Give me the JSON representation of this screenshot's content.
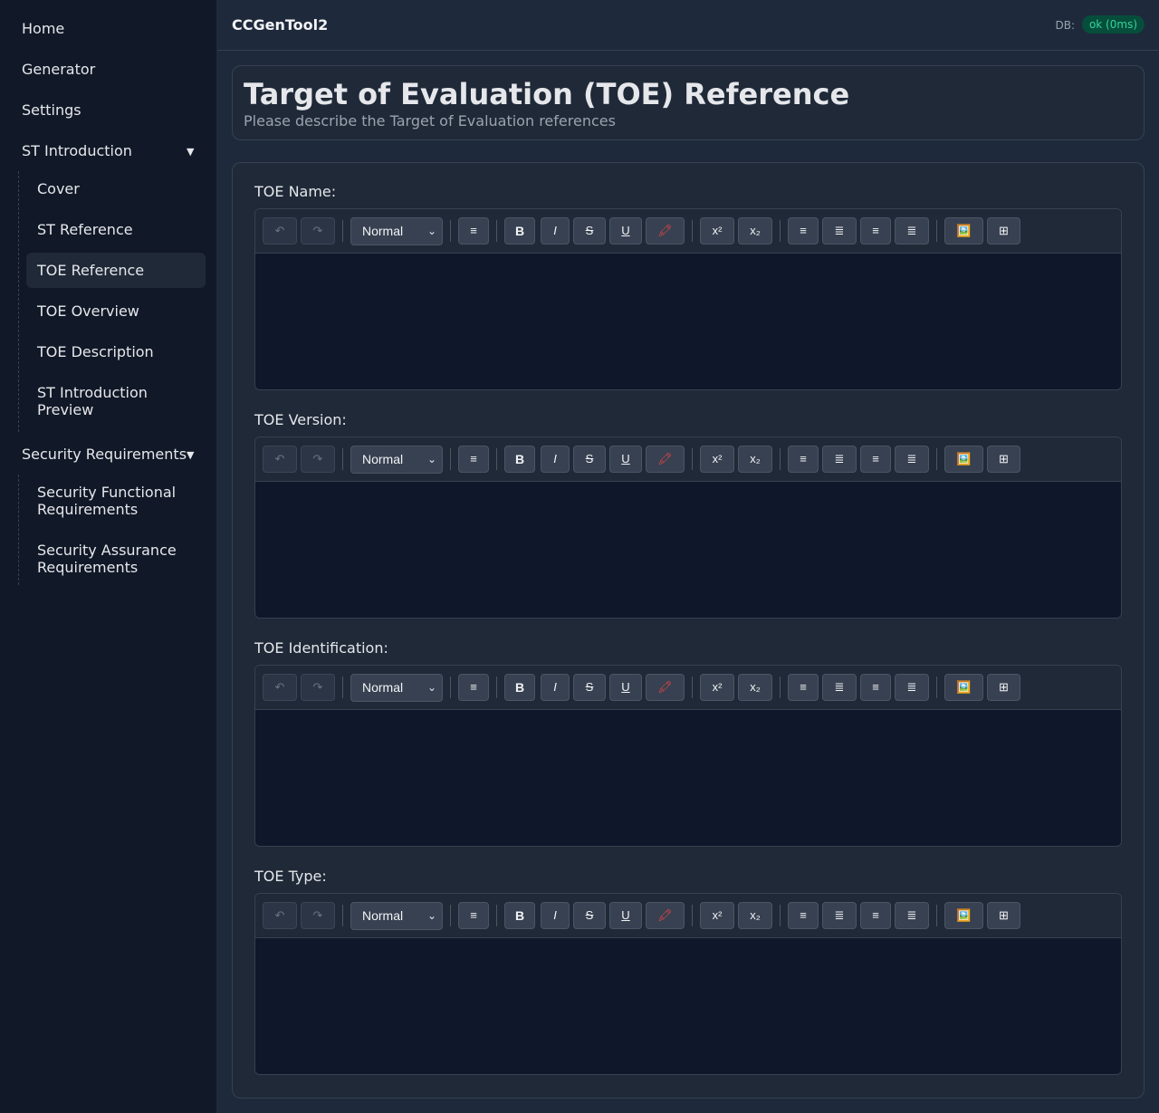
{
  "sidebar": {
    "top_items": [
      {
        "label": "Home"
      },
      {
        "label": "Generator"
      },
      {
        "label": "Settings"
      }
    ],
    "groups": [
      {
        "label": "ST Introduction",
        "caret": "▼",
        "items": [
          {
            "label": "Cover"
          },
          {
            "label": "ST Reference"
          },
          {
            "label": "TOE Reference",
            "active": true
          },
          {
            "label": "TOE Overview"
          },
          {
            "label": "TOE Description"
          },
          {
            "label": "ST Introduction Preview"
          }
        ]
      },
      {
        "label": "Security Requirements",
        "caret": "▼",
        "items": [
          {
            "label": "Security Functional Requirements"
          },
          {
            "label": "Security Assurance Requirements"
          }
        ]
      }
    ]
  },
  "header": {
    "app_title": "CCGenTool2",
    "db_label": "DB:",
    "db_status": "ok (0ms)"
  },
  "page": {
    "title": "Target of Evaluation (TOE) Reference",
    "subtitle": "Please describe the Target of Evaluation references"
  },
  "toolbar": {
    "undo": "↶",
    "redo": "↷",
    "format_select": "Normal",
    "clean": "≡",
    "bold": "B",
    "italic": "I",
    "strike": "S",
    "underline": "U",
    "highlight": "🖍",
    "superscript": "x²",
    "subscript": "x₂",
    "align_left": "≡",
    "align_center": "≣",
    "align_right": "≡",
    "align_justify": "≣",
    "image": "🖼️",
    "table": "⊞"
  },
  "fields": [
    {
      "label": "TOE Name:",
      "value": ""
    },
    {
      "label": "TOE Version:",
      "value": ""
    },
    {
      "label": "TOE Identification:",
      "value": ""
    },
    {
      "label": "TOE Type:",
      "value": ""
    }
  ],
  "colors": {
    "sidebar_bg": "#111827",
    "main_bg": "#1e293b",
    "card_bg": "#1f2937",
    "editor_bg": "#0f172a",
    "badge_bg": "#064e3b",
    "badge_text": "#34d399",
    "highlight_icon": "#ef4444"
  }
}
